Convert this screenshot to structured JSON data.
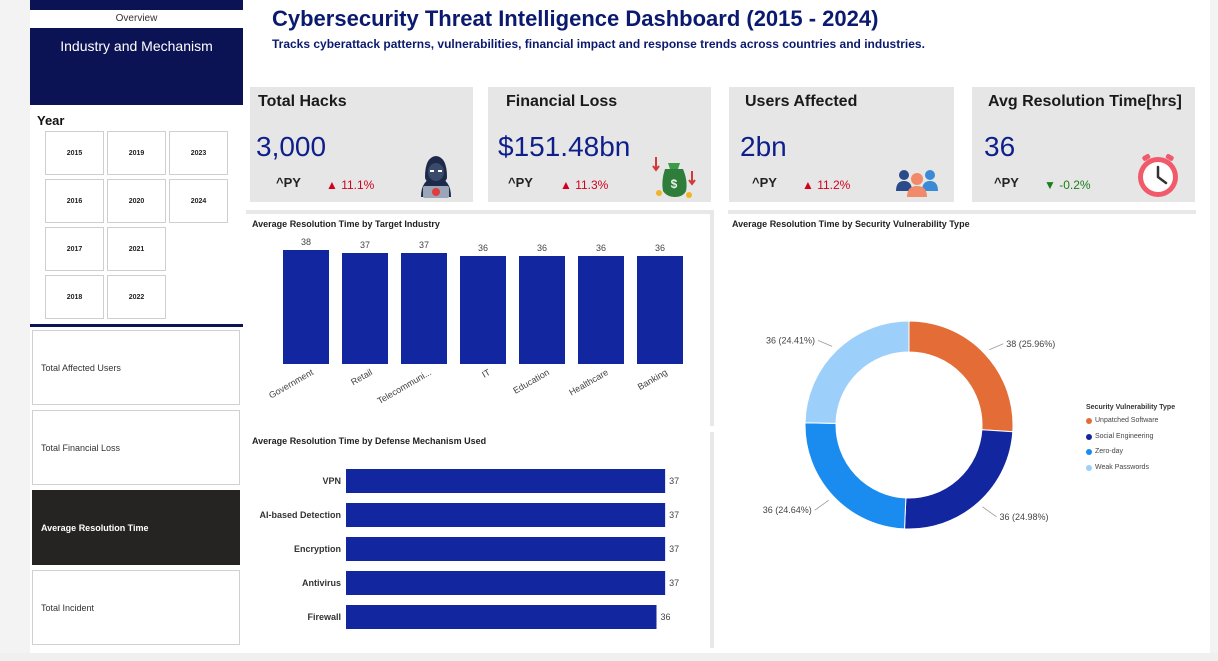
{
  "nav": {
    "overview_label": "Overview",
    "industry_label": "Industry and Mechanism",
    "year_label": "Year",
    "years": [
      "2015",
      "2016",
      "2017",
      "2018",
      "2019",
      "2020",
      "2021",
      "2022",
      "2023",
      "2024"
    ],
    "metrics": [
      "Total Affected Users",
      "Total Financial Loss",
      "Average Resolution Time",
      "Total Incident"
    ],
    "active_metric": "Average Resolution Time"
  },
  "header": {
    "title": "Cybersecurity Threat Intelligence Dashboard (2015 - 2024)",
    "subtitle": "Tracks cyberattack patterns, vulnerabilities, financial impact and response trends across countries and industries."
  },
  "kpis": [
    {
      "title": "Total Hacks",
      "value": "3,000",
      "py": "^PY",
      "change": "▲ 11.1%",
      "direction": "up",
      "icon": "hacker-icon"
    },
    {
      "title": "Financial Loss",
      "value": "$151.48bn",
      "py": "^PY",
      "change": "▲ 11.3%",
      "direction": "up",
      "icon": "money-bag-icon"
    },
    {
      "title": "Users Affected",
      "value": "2bn",
      "py": "^PY",
      "change": "▲ 11.2%",
      "direction": "up",
      "icon": "users-group-icon"
    },
    {
      "title": "Avg Resolution Time[hrs]",
      "value": "36",
      "py": "^PY",
      "change": "▼ -0.2%",
      "direction": "down",
      "icon": "clock-icon"
    }
  ],
  "colors": {
    "navy": "#0b1354",
    "bar": "#1226a0",
    "title": "#0b1a6e",
    "up": "#d0021b",
    "down": "#1a7f1a"
  },
  "chart_data": [
    {
      "type": "bar",
      "title": "Average Resolution Time by Target Industry",
      "categories": [
        "Government",
        "Retail",
        "Telecommuni...",
        "IT",
        "Education",
        "Healthcare",
        "Banking"
      ],
      "values": [
        38,
        37,
        37,
        36,
        36,
        36,
        36
      ],
      "ylim": [
        0,
        40
      ]
    },
    {
      "type": "bar",
      "orientation": "horizontal",
      "title": "Average Resolution Time by Defense Mechanism Used",
      "categories": [
        "VPN",
        "AI-based Detection",
        "Encryption",
        "Antivirus",
        "Firewall"
      ],
      "values": [
        37,
        37,
        37,
        37,
        36
      ],
      "xlim": [
        0,
        40
      ]
    },
    {
      "type": "pie",
      "title": "Average Resolution Time by Security Vulnerability Type",
      "legend_title": "Security Vulnerability Type",
      "legend_position": "right",
      "categories": [
        "Unpatched Software",
        "Social Engineering",
        "Zero-day",
        "Weak Passwords"
      ],
      "values": [
        38,
        36,
        36,
        36
      ],
      "percents": [
        "25.96%",
        "24.98%",
        "24.64%",
        "24.41%"
      ],
      "labels": [
        "38 (25.96%)",
        "36 (24.98%)",
        "36 (24.64%)",
        "36 (24.41%)"
      ],
      "colors": [
        "#e36c37",
        "#1226a0",
        "#1a8cf0",
        "#9ccffa"
      ]
    }
  ]
}
